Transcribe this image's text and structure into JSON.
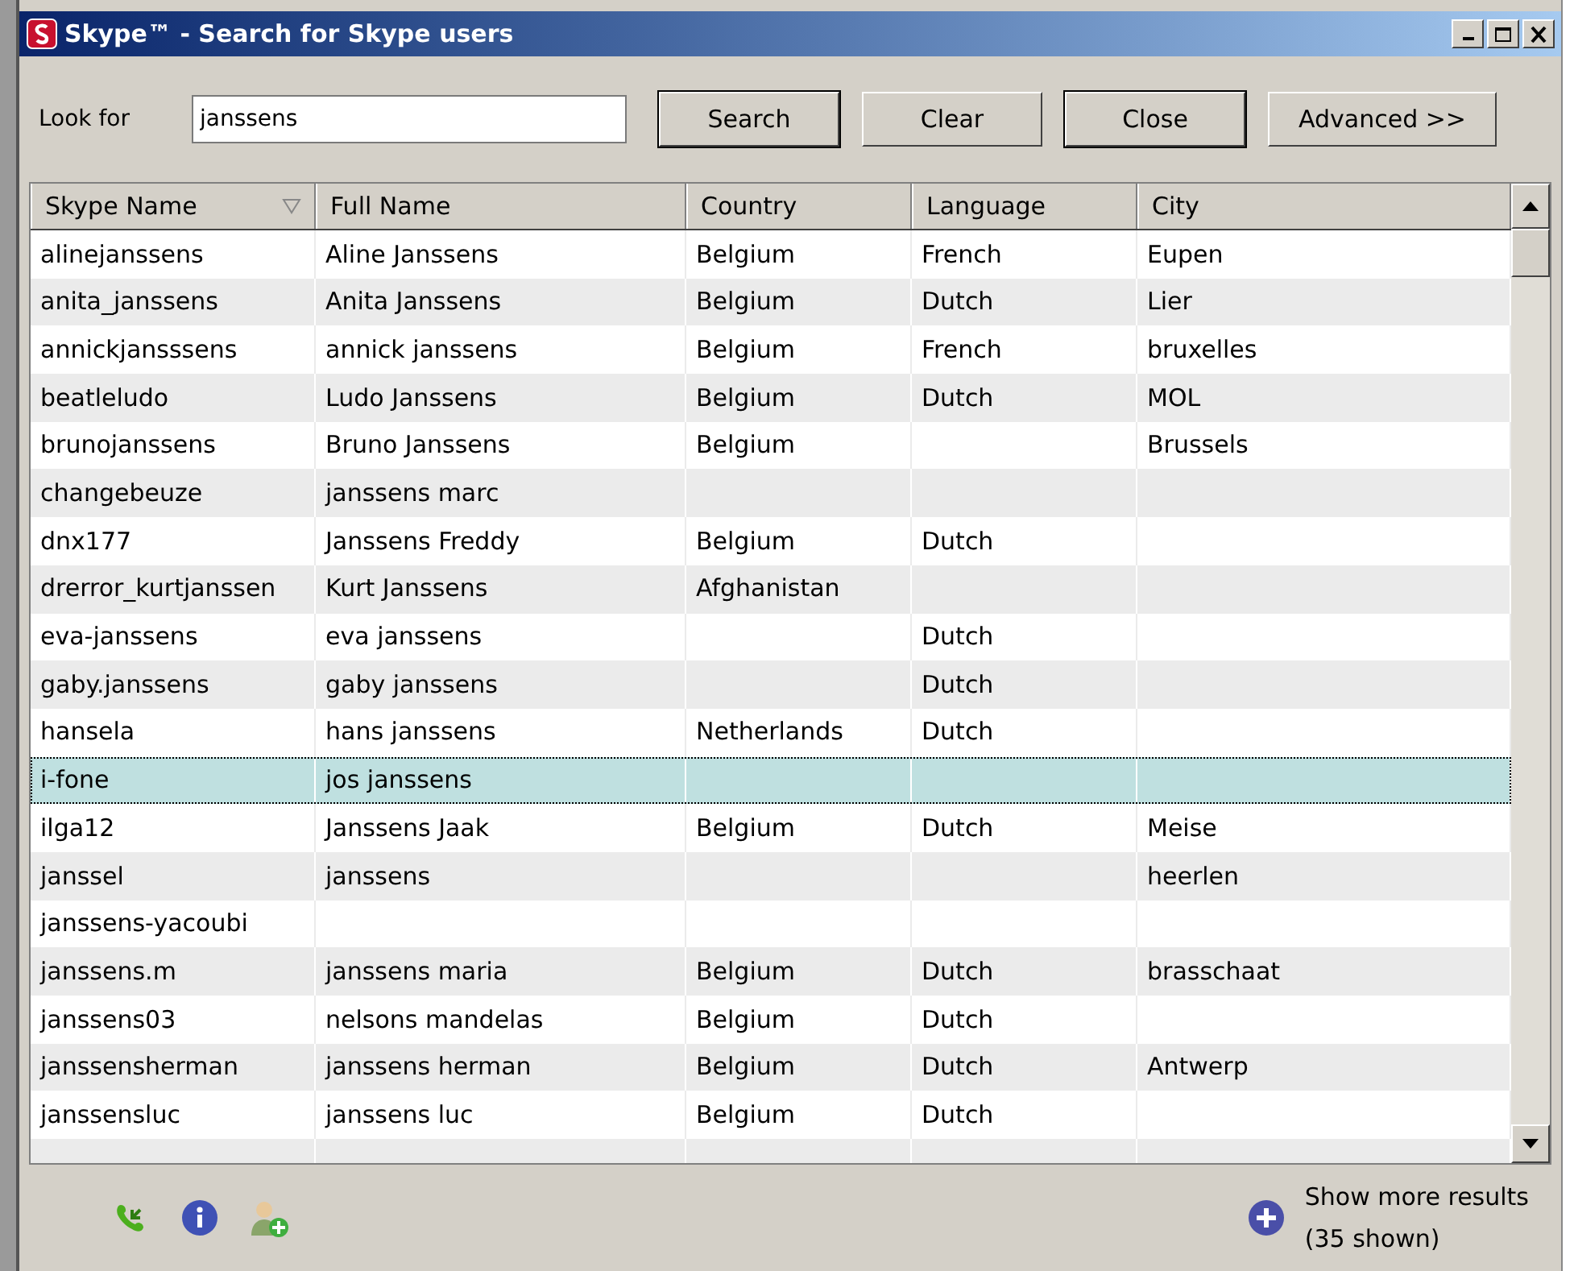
{
  "window": {
    "title": "Skype™ - Search for Skype users"
  },
  "search": {
    "label": "Look for",
    "value": "janssens"
  },
  "buttons": [
    "Search",
    "Clear",
    "Close",
    "Advanced >>"
  ],
  "table": {
    "columns": [
      "Skype Name",
      "Full Name",
      "Country",
      "Language",
      "City"
    ],
    "rows": [
      {
        "cells": [
          "alinejanssens",
          "Aline Janssens",
          "Belgium",
          "French",
          "Eupen"
        ],
        "selected": false
      },
      {
        "cells": [
          "anita_janssens",
          "Anita Janssens",
          "Belgium",
          "Dutch",
          "Lier"
        ],
        "selected": false
      },
      {
        "cells": [
          "annickjansssens",
          "annick janssens",
          "Belgium",
          "French",
          "bruxelles"
        ],
        "selected": false
      },
      {
        "cells": [
          "beatleludo",
          "Ludo Janssens",
          "Belgium",
          "Dutch",
          "MOL"
        ],
        "selected": false
      },
      {
        "cells": [
          "brunojanssens",
          "Bruno Janssens",
          "Belgium",
          "",
          "Brussels"
        ],
        "selected": false
      },
      {
        "cells": [
          "changebeuze",
          "janssens marc",
          "",
          "",
          ""
        ],
        "selected": false
      },
      {
        "cells": [
          "dnx177",
          "Janssens Freddy",
          "Belgium",
          "Dutch",
          ""
        ],
        "selected": false
      },
      {
        "cells": [
          "drerror_kurtjanssen",
          "Kurt Janssens",
          "Afghanistan",
          "",
          ""
        ],
        "selected": false
      },
      {
        "cells": [
          "eva-janssens",
          "eva janssens",
          "",
          "Dutch",
          ""
        ],
        "selected": false
      },
      {
        "cells": [
          "gaby.janssens",
          "gaby janssens",
          "",
          "Dutch",
          ""
        ],
        "selected": false
      },
      {
        "cells": [
          "hansela",
          "hans janssens",
          "Netherlands",
          "Dutch",
          ""
        ],
        "selected": false
      },
      {
        "cells": [
          "i-fone",
          "jos janssens",
          "",
          "",
          ""
        ],
        "selected": true
      },
      {
        "cells": [
          "ilga12",
          "Janssens Jaak",
          "Belgium",
          "Dutch",
          "Meise"
        ],
        "selected": false
      },
      {
        "cells": [
          "janssel",
          "janssens",
          "",
          "",
          "heerlen"
        ],
        "selected": false
      },
      {
        "cells": [
          "janssens-yacoubi",
          "",
          "",
          "",
          ""
        ],
        "selected": false
      },
      {
        "cells": [
          "janssens.m",
          "janssens maria",
          "Belgium",
          "Dutch",
          "brasschaat"
        ],
        "selected": false
      },
      {
        "cells": [
          "janssens03",
          "nelsons mandelas",
          "Belgium",
          "Dutch",
          ""
        ],
        "selected": false
      },
      {
        "cells": [
          "janssensherman",
          "janssens herman",
          "Belgium",
          "Dutch",
          "Antwerp"
        ],
        "selected": false
      },
      {
        "cells": [
          "janssensluc",
          "janssens luc",
          "Belgium",
          "Dutch",
          ""
        ],
        "selected": false
      }
    ]
  },
  "footer": {
    "more": "Show more results",
    "shown": "(35 shown)"
  }
}
